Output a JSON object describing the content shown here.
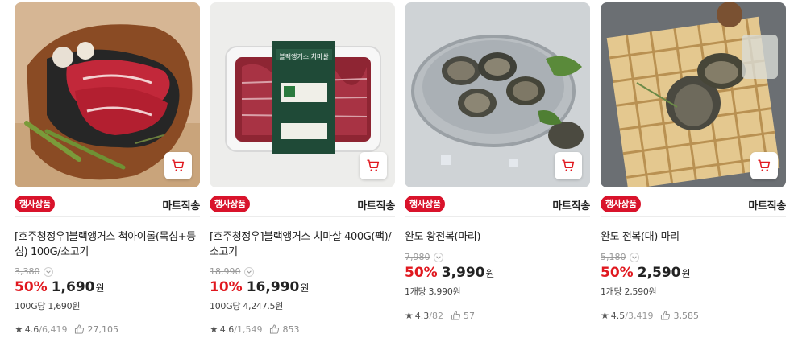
{
  "products": [
    {
      "badge": "행사상품",
      "delivery": "마트직송",
      "title": "[호주청정우]블랙앵거스 척아이롤(목심+등심) 100G/소고기",
      "original_price": "3,380",
      "discount": "50%",
      "price": "1,690",
      "currency": "원",
      "unit_price": "100G당 1,690원",
      "rating": "4.6",
      "reviews": "/6,419",
      "likes": "27,105",
      "image": "beef-steak-on-board-photo"
    },
    {
      "badge": "행사상품",
      "delivery": "마트직송",
      "title": "[호주청정우]블랙앵거스 치마살 400G(팩)/소고기",
      "original_price": "18,990",
      "discount": "10%",
      "price": "16,990",
      "currency": "원",
      "unit_price": "100G당 4,247.5원",
      "rating": "4.6",
      "reviews": "/1,549",
      "likes": "853",
      "package_label": "블랙앵거스 치마살",
      "image": "packaged-beef-tray-photo"
    },
    {
      "badge": "행사상품",
      "delivery": "마트직송",
      "title": "완도 왕전복(마리)",
      "original_price": "7,980",
      "discount": "50%",
      "price": "3,990",
      "currency": "원",
      "unit_price": "1개당 3,990원",
      "rating": "4.3",
      "reviews": "/82",
      "likes": "57",
      "image": "abalone-in-bowl-photo"
    },
    {
      "badge": "행사상품",
      "delivery": "마트직송",
      "title": "완도 전복(대) 마리",
      "original_price": "5,180",
      "discount": "50%",
      "price": "2,590",
      "currency": "원",
      "unit_price": "1개당 2,590원",
      "rating": "4.5",
      "reviews": "/3,419",
      "likes": "3,585",
      "image": "abalone-on-bamboo-mat-photo"
    }
  ],
  "icons": {
    "cart": "cart-icon",
    "star": "star-icon",
    "like": "like-icon",
    "chevron": "chevron-down-icon"
  },
  "colors": {
    "accent": "#e0181f",
    "badge": "#d9132b",
    "muted": "#9a9a9a"
  }
}
